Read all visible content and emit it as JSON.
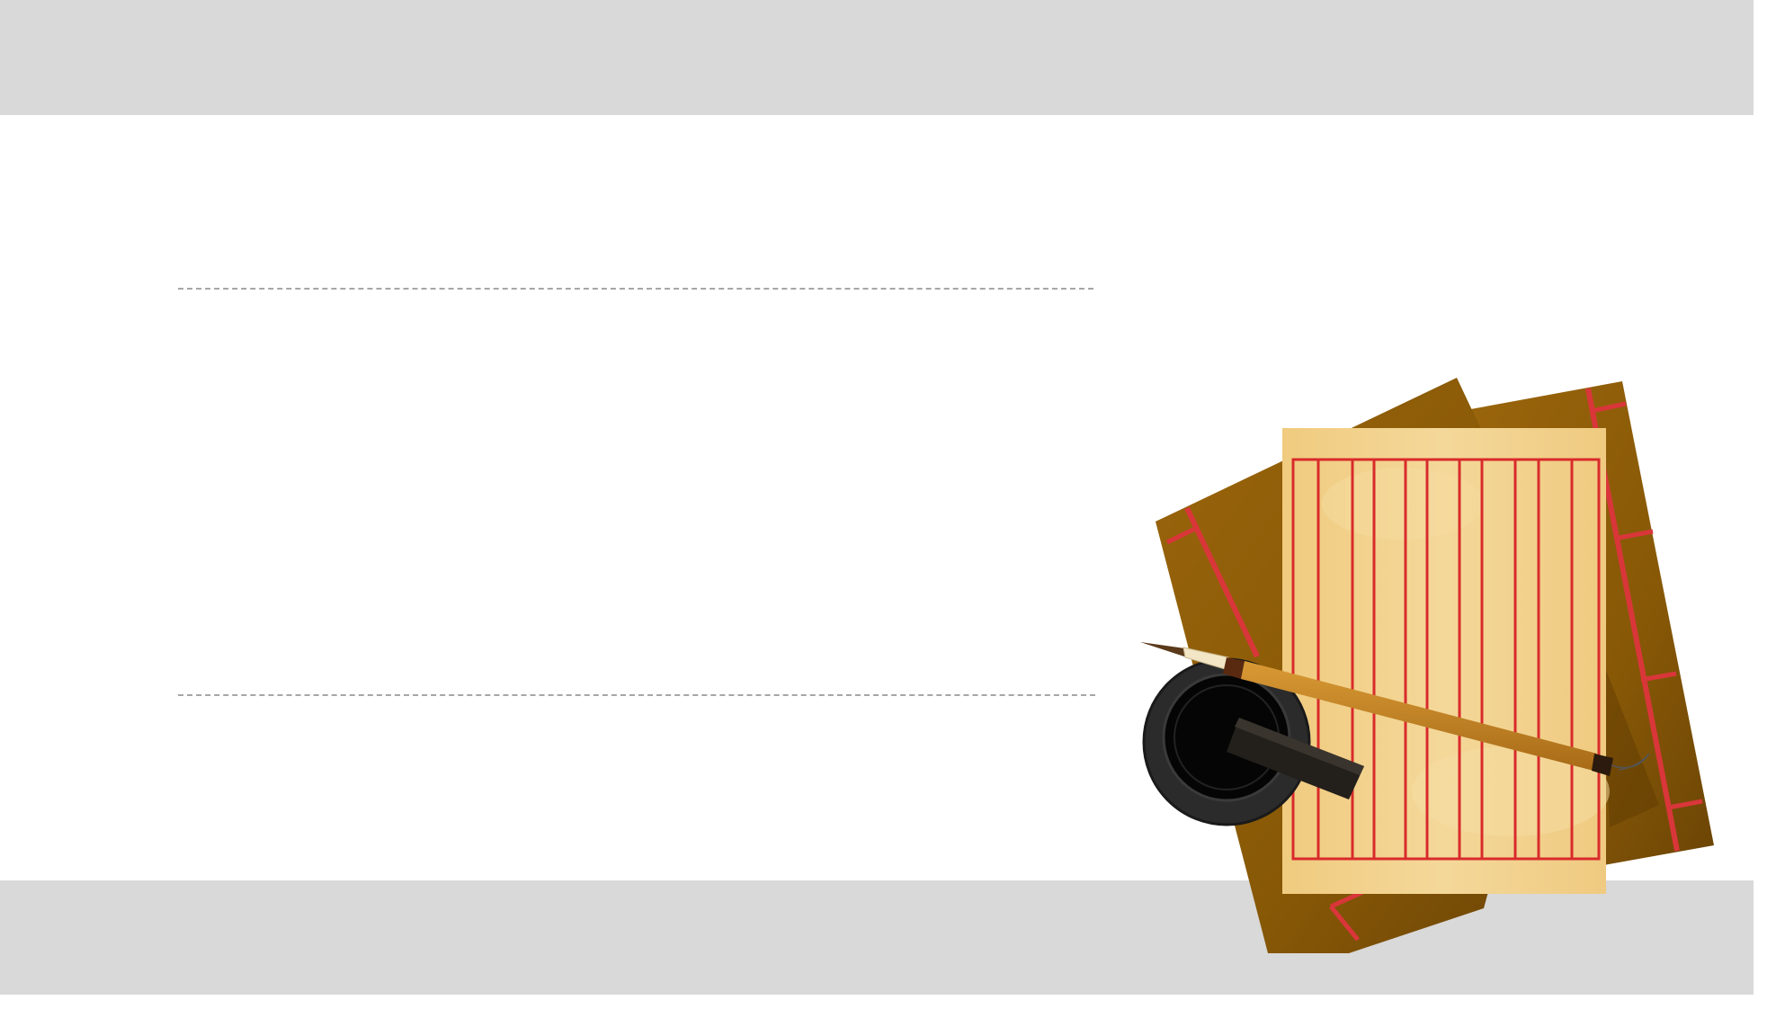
{
  "slide": {
    "background": "#ffffff",
    "band_color": "#d9d9d9",
    "divider_color": "#a6a6a6"
  },
  "illustration": {
    "items": [
      "books-icon",
      "manuscript-paper-icon",
      "calligraphy-brush-icon",
      "ink-stone-icon"
    ],
    "colors": {
      "book_cover": "#8a5a0a",
      "book_shadow": "#6b4405",
      "paper": "#f2d08a",
      "grid_lines": "#d92b2b",
      "brush_handle": "#c98a2a",
      "ink_stone": "#2b2b2b",
      "ink": "#050505"
    }
  }
}
